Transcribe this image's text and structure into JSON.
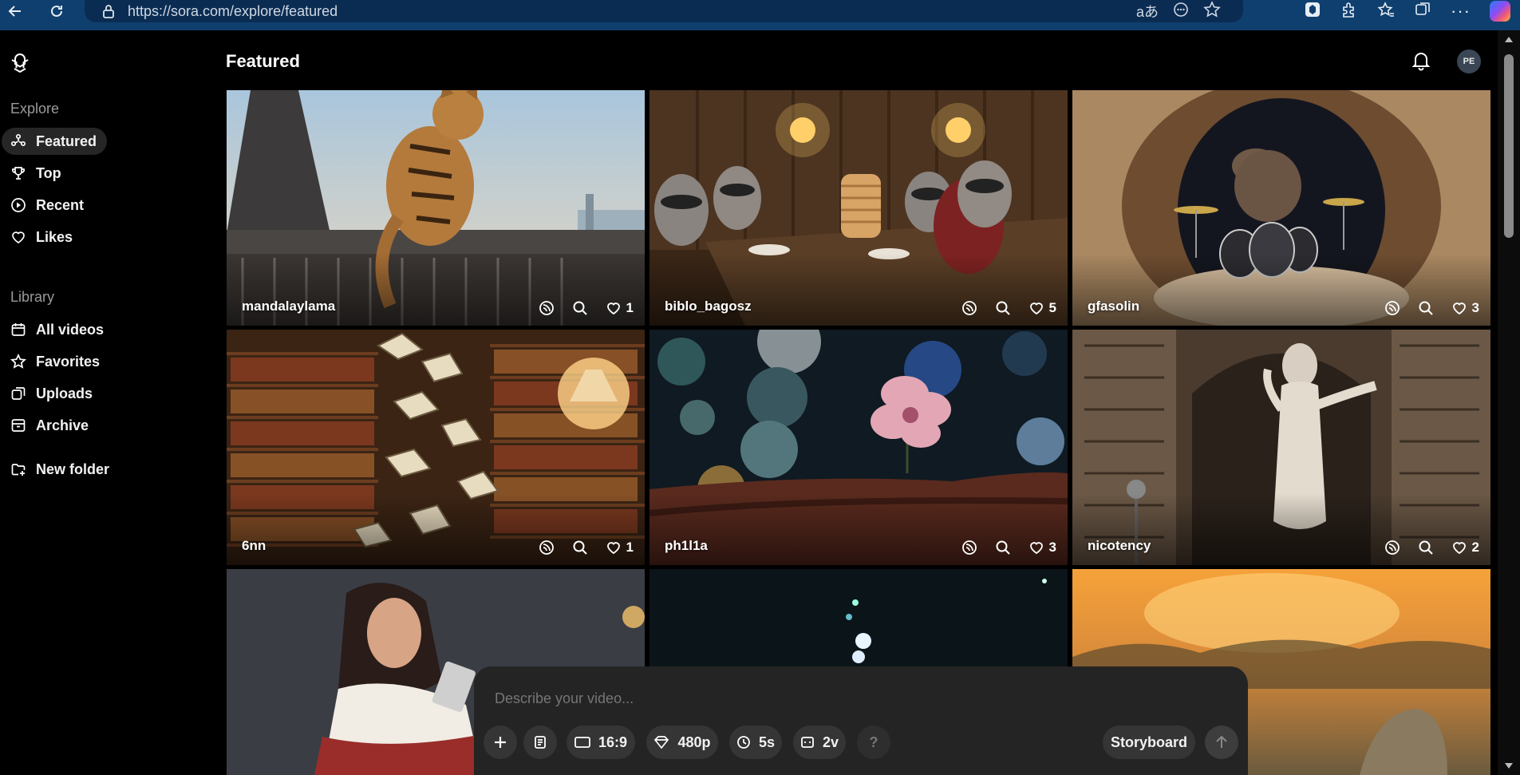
{
  "browser": {
    "url": "https://sora.com/explore/featured"
  },
  "sidebar": {
    "explore_heading": "Explore",
    "explore_items": [
      {
        "label": "Featured",
        "icon": "featured-icon"
      },
      {
        "label": "Top",
        "icon": "trophy-icon"
      },
      {
        "label": "Recent",
        "icon": "play-circle-icon"
      },
      {
        "label": "Likes",
        "icon": "heart-icon"
      }
    ],
    "library_heading": "Library",
    "library_items": [
      {
        "label": "All videos",
        "icon": "calendar-icon"
      },
      {
        "label": "Favorites",
        "icon": "star-icon"
      },
      {
        "label": "Uploads",
        "icon": "upload-icon"
      },
      {
        "label": "Archive",
        "icon": "archive-icon"
      }
    ],
    "new_folder": "New folder"
  },
  "header": {
    "title": "Featured",
    "avatar_initials": "PE"
  },
  "videos": [
    {
      "author": "mandalaylama",
      "likes": "1",
      "theme": "cat-eiffel"
    },
    {
      "author": "biblo_bagosz",
      "likes": "5",
      "theme": "raccoons"
    },
    {
      "author": "gfasolin",
      "likes": "3",
      "theme": "rat-drums"
    },
    {
      "author": "6nn",
      "likes": "1",
      "theme": "books"
    },
    {
      "author": "ph1l1a",
      "likes": "3",
      "theme": "flower"
    },
    {
      "author": "nicotency",
      "likes": "2",
      "theme": "singer"
    },
    {
      "author": "",
      "likes": "",
      "theme": "woman"
    },
    {
      "author": "",
      "likes": "",
      "theme": "dark"
    },
    {
      "author": "",
      "likes": "",
      "theme": "sunset"
    }
  ],
  "composer": {
    "placeholder": "Describe your video...",
    "aspect": "16:9",
    "resolution": "480p",
    "duration": "5s",
    "variations": "2v",
    "help": "?",
    "storyboard": "Storyboard"
  },
  "colors": {
    "browser_bar": "#0f3f6e",
    "address_bar": "#0b2c52",
    "active_nav": "#262626",
    "composer_bg": "#242424",
    "pill_bg": "#353535"
  }
}
